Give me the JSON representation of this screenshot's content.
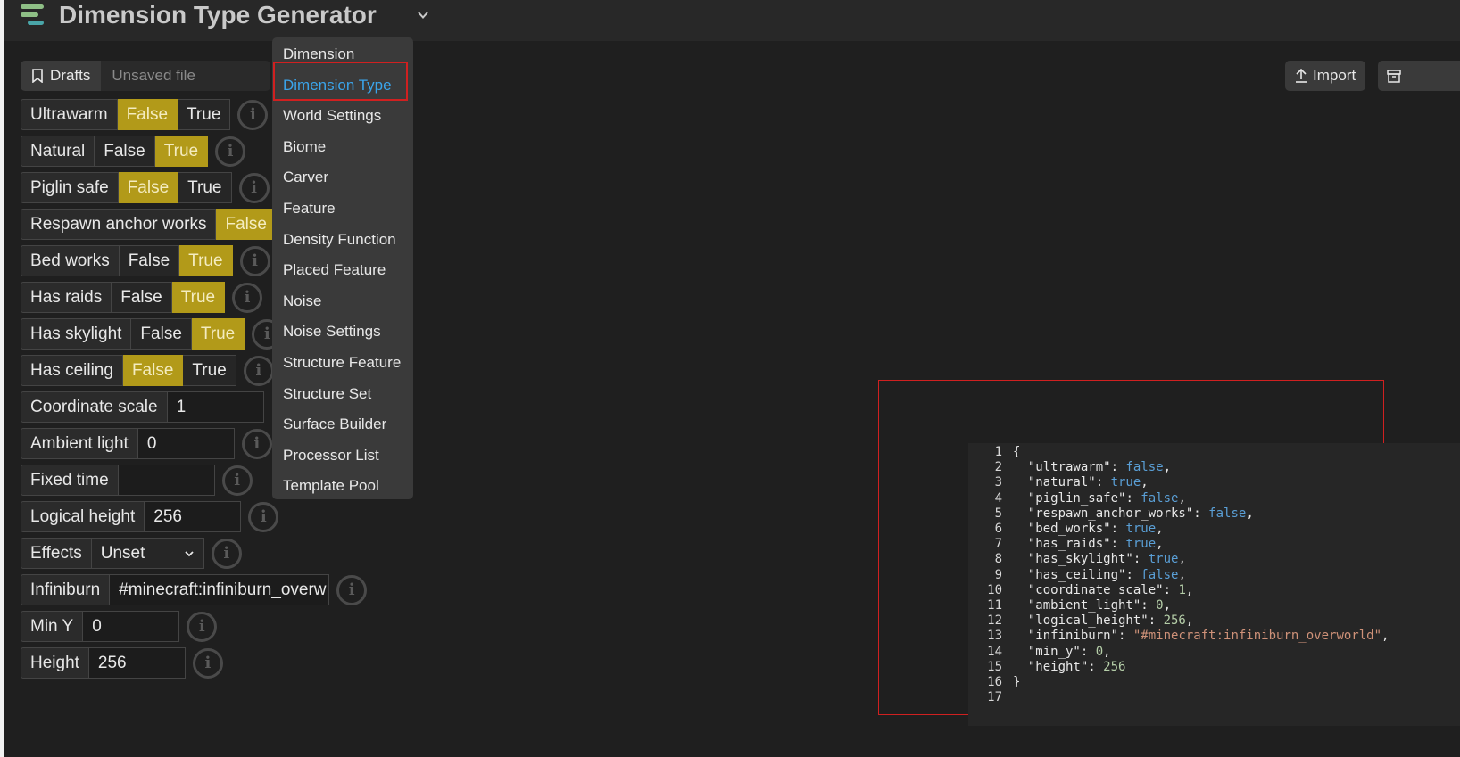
{
  "header": {
    "title": "Dimension Type Generator"
  },
  "tabs": {
    "drafts": "Drafts",
    "unsaved": "Unsaved file"
  },
  "fields": {
    "ultrawarm": {
      "label": "Ultrawarm",
      "false": "False",
      "true": "True",
      "value": "False"
    },
    "natural": {
      "label": "Natural",
      "false": "False",
      "true": "True",
      "value": "True"
    },
    "piglin_safe": {
      "label": "Piglin safe",
      "false": "False",
      "true": "True",
      "value": "False"
    },
    "respawn_anchor_works": {
      "label": "Respawn anchor works",
      "false": "False",
      "value": "False"
    },
    "bed_works": {
      "label": "Bed works",
      "false": "False",
      "true": "True",
      "value": "True"
    },
    "has_raids": {
      "label": "Has raids",
      "false": "False",
      "true": "True",
      "value": "True"
    },
    "has_skylight": {
      "label": "Has skylight",
      "false": "False",
      "true": "True",
      "value": "True"
    },
    "has_ceiling": {
      "label": "Has ceiling",
      "false": "False",
      "true": "True",
      "value": "False"
    },
    "coordinate_scale": {
      "label": "Coordinate scale",
      "value": "1"
    },
    "ambient_light": {
      "label": "Ambient light",
      "value": "0"
    },
    "fixed_time": {
      "label": "Fixed time",
      "value": ""
    },
    "logical_height": {
      "label": "Logical height",
      "value": "256"
    },
    "effects": {
      "label": "Effects",
      "value": "Unset"
    },
    "infiniburn": {
      "label": "Infiniburn",
      "value": "#minecraft:infiniburn_overw"
    },
    "min_y": {
      "label": "Min Y",
      "value": "0"
    },
    "height": {
      "label": "Height",
      "value": "256"
    }
  },
  "dropdown": {
    "selected": "Dimension Type",
    "items": [
      "Dimension",
      "Dimension Type",
      "World Settings",
      "Biome",
      "Carver",
      "Feature",
      "Density Function",
      "Placed Feature",
      "Noise",
      "Noise Settings",
      "Structure Feature",
      "Structure Set",
      "Surface Builder",
      "Processor List",
      "Template Pool"
    ]
  },
  "toolbar": {
    "import_label": "Import"
  },
  "code": {
    "line_numbers": [
      "1",
      "2",
      "3",
      "4",
      "5",
      "6",
      "7",
      "8",
      "9",
      "10",
      "11",
      "12",
      "13",
      "14",
      "15",
      "16",
      "17"
    ],
    "lines": [
      [
        [
          "p",
          "{"
        ]
      ],
      [
        [
          "p",
          "  "
        ],
        [
          "k",
          "\"ultrawarm\""
        ],
        [
          "p",
          ": "
        ],
        [
          "b",
          "false"
        ],
        [
          "p",
          ","
        ]
      ],
      [
        [
          "p",
          "  "
        ],
        [
          "k",
          "\"natural\""
        ],
        [
          "p",
          ": "
        ],
        [
          "b",
          "true"
        ],
        [
          "p",
          ","
        ]
      ],
      [
        [
          "p",
          "  "
        ],
        [
          "k",
          "\"piglin_safe\""
        ],
        [
          "p",
          ": "
        ],
        [
          "b",
          "false"
        ],
        [
          "p",
          ","
        ]
      ],
      [
        [
          "p",
          "  "
        ],
        [
          "k",
          "\"respawn_anchor_works\""
        ],
        [
          "p",
          ": "
        ],
        [
          "b",
          "false"
        ],
        [
          "p",
          ","
        ]
      ],
      [
        [
          "p",
          "  "
        ],
        [
          "k",
          "\"bed_works\""
        ],
        [
          "p",
          ": "
        ],
        [
          "b",
          "true"
        ],
        [
          "p",
          ","
        ]
      ],
      [
        [
          "p",
          "  "
        ],
        [
          "k",
          "\"has_raids\""
        ],
        [
          "p",
          ": "
        ],
        [
          "b",
          "true"
        ],
        [
          "p",
          ","
        ]
      ],
      [
        [
          "p",
          "  "
        ],
        [
          "k",
          "\"has_skylight\""
        ],
        [
          "p",
          ": "
        ],
        [
          "b",
          "true"
        ],
        [
          "p",
          ","
        ]
      ],
      [
        [
          "p",
          "  "
        ],
        [
          "k",
          "\"has_ceiling\""
        ],
        [
          "p",
          ": "
        ],
        [
          "b",
          "false"
        ],
        [
          "p",
          ","
        ]
      ],
      [
        [
          "p",
          "  "
        ],
        [
          "k",
          "\"coordinate_scale\""
        ],
        [
          "p",
          ": "
        ],
        [
          "n",
          "1"
        ],
        [
          "p",
          ","
        ]
      ],
      [
        [
          "p",
          "  "
        ],
        [
          "k",
          "\"ambient_light\""
        ],
        [
          "p",
          ": "
        ],
        [
          "n",
          "0"
        ],
        [
          "p",
          ","
        ]
      ],
      [
        [
          "p",
          "  "
        ],
        [
          "k",
          "\"logical_height\""
        ],
        [
          "p",
          ": "
        ],
        [
          "n",
          "256"
        ],
        [
          "p",
          ","
        ]
      ],
      [
        [
          "p",
          "  "
        ],
        [
          "k",
          "\"infiniburn\""
        ],
        [
          "p",
          ": "
        ],
        [
          "s",
          "\"#minecraft:infiniburn_overworld\""
        ],
        [
          "p",
          ","
        ]
      ],
      [
        [
          "p",
          "  "
        ],
        [
          "k",
          "\"min_y\""
        ],
        [
          "p",
          ": "
        ],
        [
          "n",
          "0"
        ],
        [
          "p",
          ","
        ]
      ],
      [
        [
          "p",
          "  "
        ],
        [
          "k",
          "\"height\""
        ],
        [
          "p",
          ": "
        ],
        [
          "n",
          "256"
        ]
      ],
      [
        [
          "p",
          "}"
        ]
      ],
      []
    ]
  },
  "colors": {
    "accent": "#b29a19",
    "link": "#3aa4ea",
    "highlight_border": "#d02020"
  }
}
